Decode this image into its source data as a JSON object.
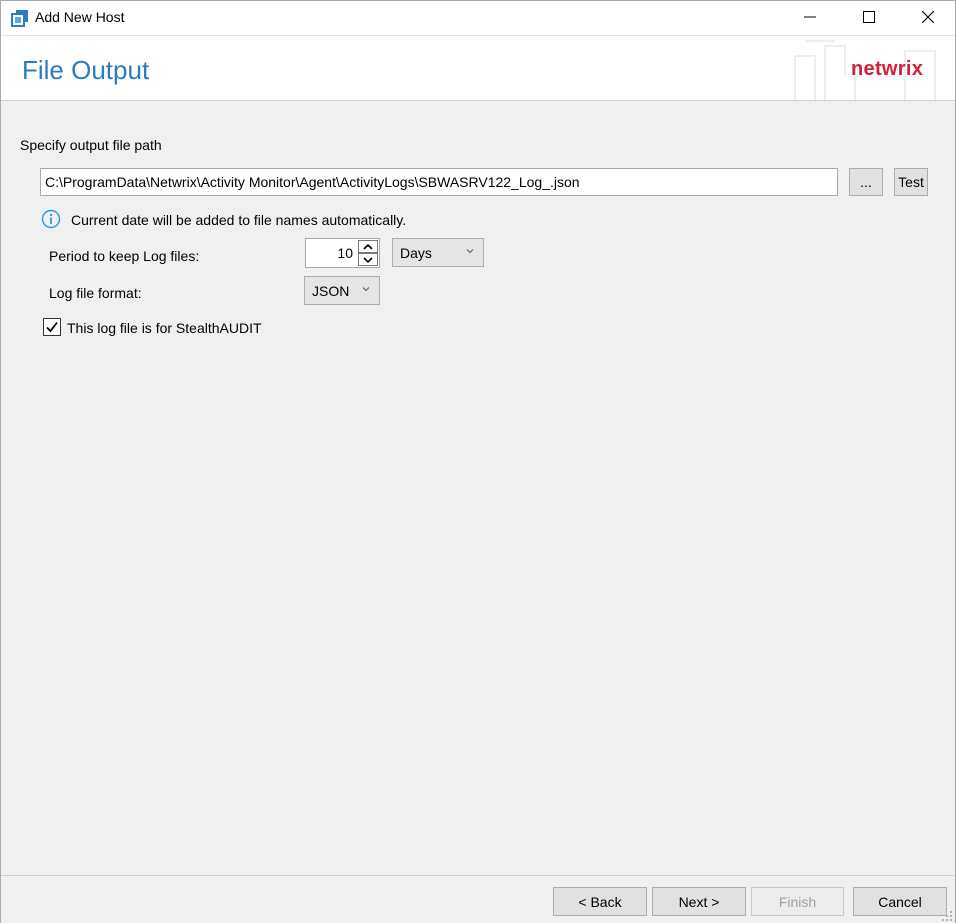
{
  "window": {
    "title": "Add New Host"
  },
  "header": {
    "page_title": "File Output",
    "brand": "netwrix",
    "brand_color": "#d2203a",
    "title_color": "#2a7bbf"
  },
  "output": {
    "path_label": "Specify output file path",
    "path_value": "C:\\ProgramData\\Netwrix\\Activity Monitor\\Agent\\ActivityLogs\\SBWASRV122_Log_.json",
    "browse_label": "...",
    "test_label": "Test",
    "info_text": "Current date will be added to file names automatically.",
    "period_label": "Period to keep Log files:",
    "period_value": "10",
    "period_unit": "Days",
    "format_label": "Log file format:",
    "format_value": "JSON",
    "stealth_label": "This log file is for StealthAUDIT",
    "stealth_checked": true
  },
  "footer": {
    "back_label": "< Back",
    "next_label": "Next >",
    "finish_label": "Finish",
    "cancel_label": "Cancel"
  },
  "icons": [
    "app-icon",
    "minimize-icon",
    "maximize-icon",
    "close-icon",
    "info-icon",
    "spin-up-icon",
    "spin-down-icon",
    "chevron-down-icon",
    "checkmark-icon",
    "resize-grip-icon"
  ]
}
